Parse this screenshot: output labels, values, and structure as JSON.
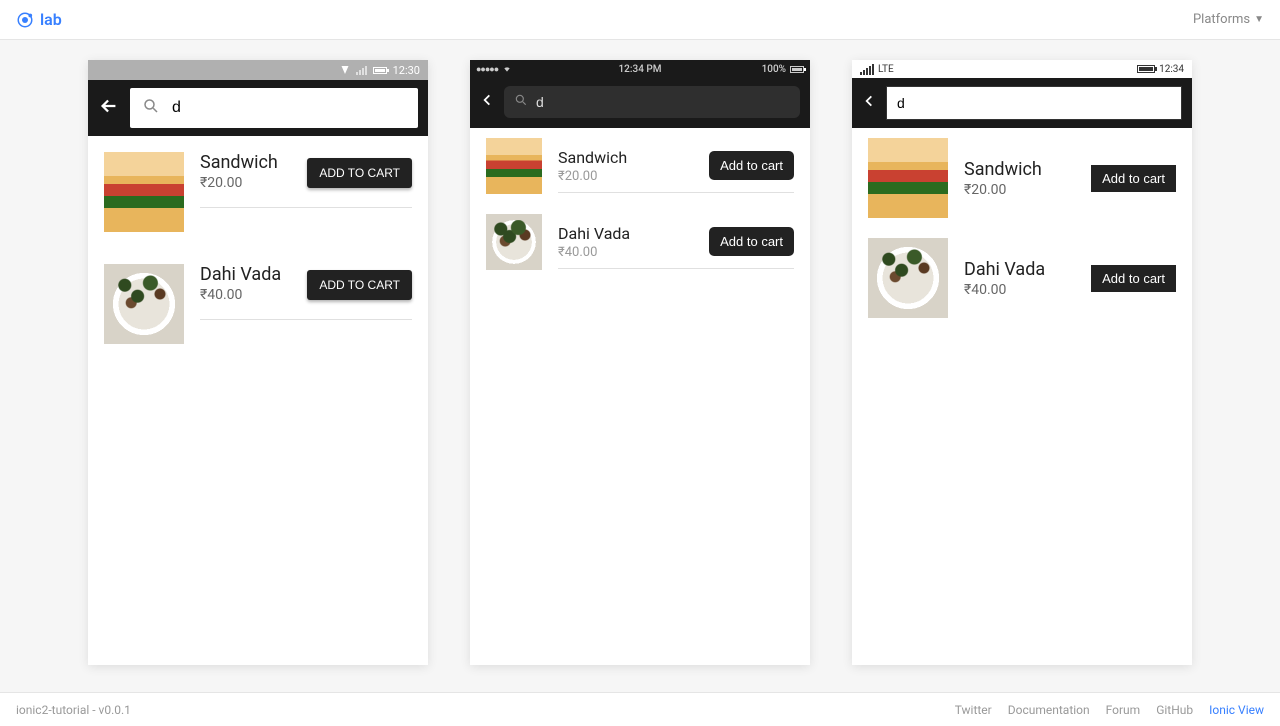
{
  "topbar": {
    "logo_text": "lab",
    "platforms_label": "Platforms"
  },
  "status": {
    "android_time": "12:30",
    "ios_time": "12:34 PM",
    "ios_battery": "100%",
    "wp_carrier": "LTE",
    "wp_time": "12:34"
  },
  "search": {
    "value": "d"
  },
  "buttons": {
    "android_add": "ADD TO CART",
    "ios_add": "Add to cart",
    "wp_add": "Add to cart"
  },
  "items": [
    {
      "name": "Sandwich",
      "price": "₹20.00",
      "img": "sandwich"
    },
    {
      "name": "Dahi Vada",
      "price": "₹40.00",
      "img": "dahivada"
    }
  ],
  "footer": {
    "app_info": "ionic2-tutorial - v0.0.1",
    "links": {
      "twitter": "Twitter",
      "docs": "Documentation",
      "forum": "Forum",
      "github": "GitHub",
      "ionic_view": "Ionic View"
    }
  }
}
